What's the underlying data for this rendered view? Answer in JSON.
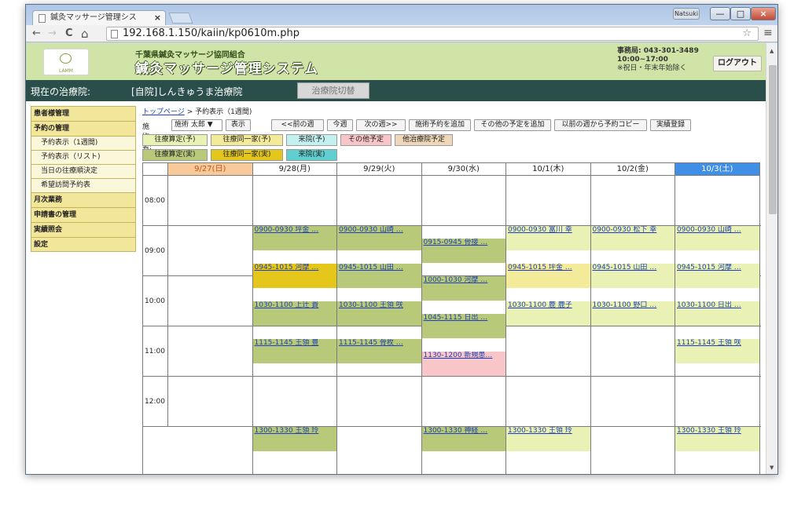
{
  "browser": {
    "tab_title": "鍼灸マッサージ管理シス",
    "tab_close": "×",
    "user_badge": "Natsuki",
    "url": "192.168.1.150/kaiin/kp0610m.php",
    "win_min": "—",
    "win_max": "□",
    "win_close": "×",
    "nav_back": "←",
    "nav_forward": "→",
    "nav_reload": "C",
    "nav_home": "⌂",
    "star": "☆",
    "menu": "≡"
  },
  "header": {
    "logo_text": "LAMM",
    "org_name": "千葉県鍼灸マッサージ協同組合",
    "system_name": "鍼灸マッサージ管理システム",
    "contact_phone": "事務局: 043-301-3489",
    "contact_hours": "10:00~17:00",
    "contact_note": "※祝日・年末年始除く",
    "logout_label": "ログアウト"
  },
  "clinic_bar": {
    "label": "現在の治療院:",
    "clinic_name": "[自院]しんきゅうま治療院",
    "switch_label": "治療院切替"
  },
  "sidebar": {
    "items": [
      {
        "label": "患者様管理",
        "type": "main"
      },
      {
        "label": "予約の管理",
        "type": "main"
      },
      {
        "label": "予約表示（1週間)",
        "type": "sub"
      },
      {
        "label": "予約表示（リスト)",
        "type": "sub"
      },
      {
        "label": "当日の往療順決定",
        "type": "sub"
      },
      {
        "label": "希望訪問予約表",
        "type": "sub"
      },
      {
        "label": "月次業務",
        "type": "main"
      },
      {
        "label": "申請書の管理",
        "type": "main"
      },
      {
        "label": "実績照会",
        "type": "main"
      },
      {
        "label": "設定",
        "type": "main"
      }
    ]
  },
  "breadcrumb": {
    "top_link": "トップページ",
    "separator": ">",
    "current": "予約表示（1週間)"
  },
  "controls": {
    "practitioner_label": "施術者:",
    "practitioner_value": "施術 太郎 ▼",
    "show_button": "表示",
    "prev_week": "<<前の週",
    "this_week": "今週",
    "next_week": "次の週>>",
    "add_treatment": "施術予約を追加",
    "add_other": "その他の予定を追加",
    "copy_prev": "以前の週から予約コピー",
    "record_actual": "実績登録"
  },
  "legend": {
    "row1": [
      {
        "label": "往療算定(予)",
        "color": "#e9f2b4"
      },
      {
        "label": "往療同一家(予)",
        "color": "#f3ea9a"
      },
      {
        "label": "来院(予)",
        "color": "#c4f0ef"
      },
      {
        "label": "その他予定",
        "color": "#f8c6c8"
      },
      {
        "label": "他治療院予定",
        "color": "#efd8b9"
      }
    ],
    "row2": [
      {
        "label": "往療算定(実)",
        "color": "#b8c97a"
      },
      {
        "label": "往療同一家(実)",
        "color": "#e4c71a"
      },
      {
        "label": "来院(実)",
        "color": "#5fd0cf"
      }
    ]
  },
  "calendar": {
    "days": [
      {
        "label": "9/27(日)",
        "bg": "#f8c999",
        "color": "#c0561b"
      },
      {
        "label": "9/28(月)",
        "bg": "#ffffff",
        "color": "#222222"
      },
      {
        "label": "9/29(火)",
        "bg": "#ffffff",
        "color": "#222222"
      },
      {
        "label": "9/30(水)",
        "bg": "#ffffff",
        "color": "#222222"
      },
      {
        "label": "10/1(木)",
        "bg": "#ffffff",
        "color": "#222222"
      },
      {
        "label": "10/2(金)",
        "bg": "#ffffff",
        "color": "#222222"
      },
      {
        "label": "10/3(土)",
        "bg": "#3f8fe6",
        "color": "#ffffff"
      }
    ],
    "hours": [
      "08:00",
      "09:00",
      "10:00",
      "11:00",
      "12:00"
    ],
    "appointments": [
      {
        "day": 1,
        "start": "09:00",
        "end": "09:30",
        "text": "0900-0930 坪金 …",
        "color": "#b8c97a"
      },
      {
        "day": 1,
        "start": "09:45",
        "end": "10:15",
        "text": "0945-1015 河摩 …",
        "color": "#e4c71a"
      },
      {
        "day": 1,
        "start": "10:30",
        "end": "11:00",
        "text": "1030-1100 上辻 貴",
        "color": "#b8c97a"
      },
      {
        "day": 1,
        "start": "11:15",
        "end": "11:45",
        "text": "1115-1145 王領 豊",
        "color": "#b8c97a"
      },
      {
        "day": 1,
        "start": "13:00",
        "end": "13:30",
        "text": "1300-1330 王領 玲",
        "color": "#b8c97a"
      },
      {
        "day": 2,
        "start": "09:00",
        "end": "09:30",
        "text": "0900-0930 山崎 …",
        "color": "#b8c97a"
      },
      {
        "day": 2,
        "start": "09:45",
        "end": "10:15",
        "text": "0945-1015 山田 …",
        "color": "#b8c97a"
      },
      {
        "day": 2,
        "start": "10:30",
        "end": "11:00",
        "text": "1030-1100 王領 咲",
        "color": "#b8c97a"
      },
      {
        "day": 2,
        "start": "11:15",
        "end": "11:45",
        "text": "1115-1145 骨枚 …",
        "color": "#b8c97a"
      },
      {
        "day": 3,
        "start": "09:15",
        "end": "09:45",
        "text": "0915-0945 骨接 …",
        "color": "#b8c97a"
      },
      {
        "day": 3,
        "start": "10:00",
        "end": "10:30",
        "text": "1000-1030 河摩 …",
        "color": "#b8c97a"
      },
      {
        "day": 3,
        "start": "10:45",
        "end": "11:15",
        "text": "1045-1115 日出 …",
        "color": "#b8c97a"
      },
      {
        "day": 3,
        "start": "11:30",
        "end": "12:00",
        "text": "1130-1200 新規患…",
        "color": "#f8c6c8"
      },
      {
        "day": 3,
        "start": "13:00",
        "end": "13:30",
        "text": "1300-1330 神経 …",
        "color": "#b8c97a"
      },
      {
        "day": 4,
        "start": "09:00",
        "end": "09:30",
        "text": "0900-0930 富川 幸",
        "color": "#e9f2b4"
      },
      {
        "day": 4,
        "start": "09:45",
        "end": "10:15",
        "text": "0945-1015 坪金 …",
        "color": "#f3ea9a"
      },
      {
        "day": 4,
        "start": "10:30",
        "end": "11:00",
        "text": "1030-1100 鹿 鹿子",
        "color": "#e9f2b4"
      },
      {
        "day": 4,
        "start": "13:00",
        "end": "13:30",
        "text": "1300-1330 王領 玲",
        "color": "#e9f2b4"
      },
      {
        "day": 5,
        "start": "09:00",
        "end": "09:30",
        "text": "0900-0930 松下 幸",
        "color": "#e9f2b4"
      },
      {
        "day": 5,
        "start": "09:45",
        "end": "10:15",
        "text": "0945-1015 山田 …",
        "color": "#e9f2b4"
      },
      {
        "day": 5,
        "start": "10:30",
        "end": "11:00",
        "text": "1030-1100 野口 …",
        "color": "#e9f2b4"
      },
      {
        "day": 6,
        "start": "09:00",
        "end": "09:30",
        "text": "0900-0930 山崎 …",
        "color": "#e9f2b4"
      },
      {
        "day": 6,
        "start": "09:45",
        "end": "10:15",
        "text": "0945-1015 河摩 …",
        "color": "#e9f2b4"
      },
      {
        "day": 6,
        "start": "10:30",
        "end": "11:00",
        "text": "1030-1100 日出 …",
        "color": "#e9f2b4"
      },
      {
        "day": 6,
        "start": "11:15",
        "end": "11:45",
        "text": "1115-1145 王領 咲",
        "color": "#e9f2b4"
      },
      {
        "day": 6,
        "start": "13:00",
        "end": "13:30",
        "text": "1300-1330 王領 玲",
        "color": "#e9f2b4"
      }
    ]
  }
}
